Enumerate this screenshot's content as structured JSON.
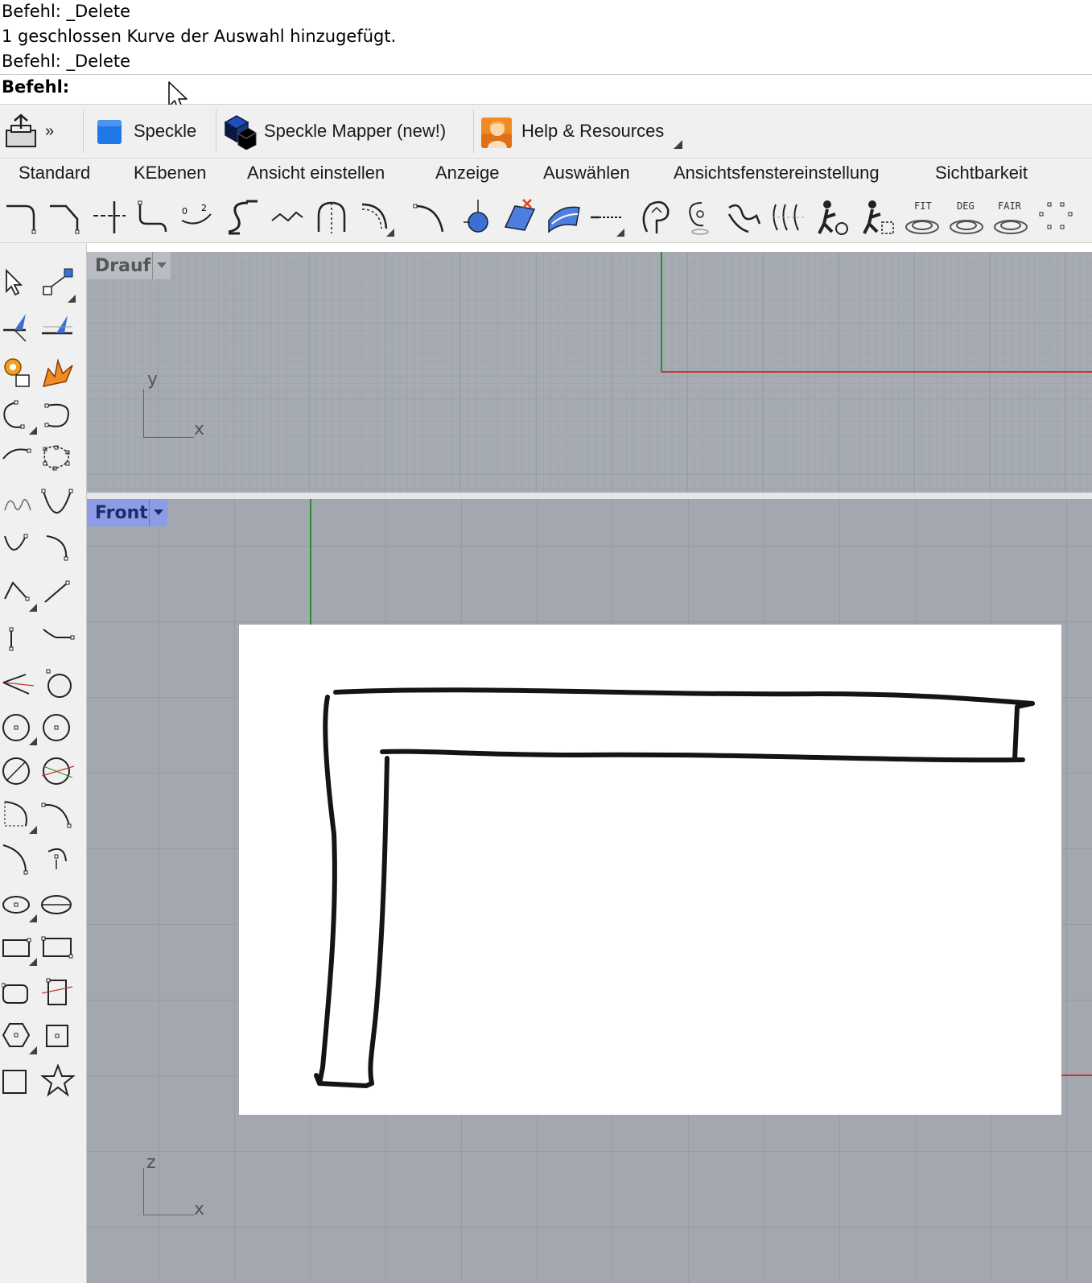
{
  "command": {
    "history": [
      "Befehl: _Delete",
      "1 geschlossen Kurve der Auswahl hinzugefügt.",
      "Befehl: _Delete"
    ],
    "prompt_label": "Befehl:",
    "input_value": ""
  },
  "plugin_toolbar": {
    "items": [
      {
        "label": "Speckle",
        "icon": "speckle-cube-icon"
      },
      {
        "label": "Speckle Mapper (new!)",
        "icon": "speckle-mapper-icon"
      },
      {
        "label": "Help & Resources",
        "icon": "help-person-icon"
      }
    ],
    "overflow_label": "»"
  },
  "tabs": [
    "Standard",
    "KEbenen",
    "Ansicht einstellen",
    "Anzeige",
    "Auswählen",
    "Ansichtsfenstereinstellung",
    "Sichtbarkeit"
  ],
  "curve_tools": {
    "text_icons": [
      "FIT",
      "DEG",
      "FAIR"
    ]
  },
  "viewports": {
    "top": {
      "label": "Drauf",
      "axis_y": "y",
      "axis_x": "x"
    },
    "front": {
      "label": "Front",
      "axis_z": "z",
      "axis_x": "x"
    }
  },
  "colors": {
    "x_axis": "#c83232",
    "y_axis": "#2e8b2e",
    "front_label_bg": "#8e9ce7",
    "viewport_bg": "#a7acb3"
  }
}
